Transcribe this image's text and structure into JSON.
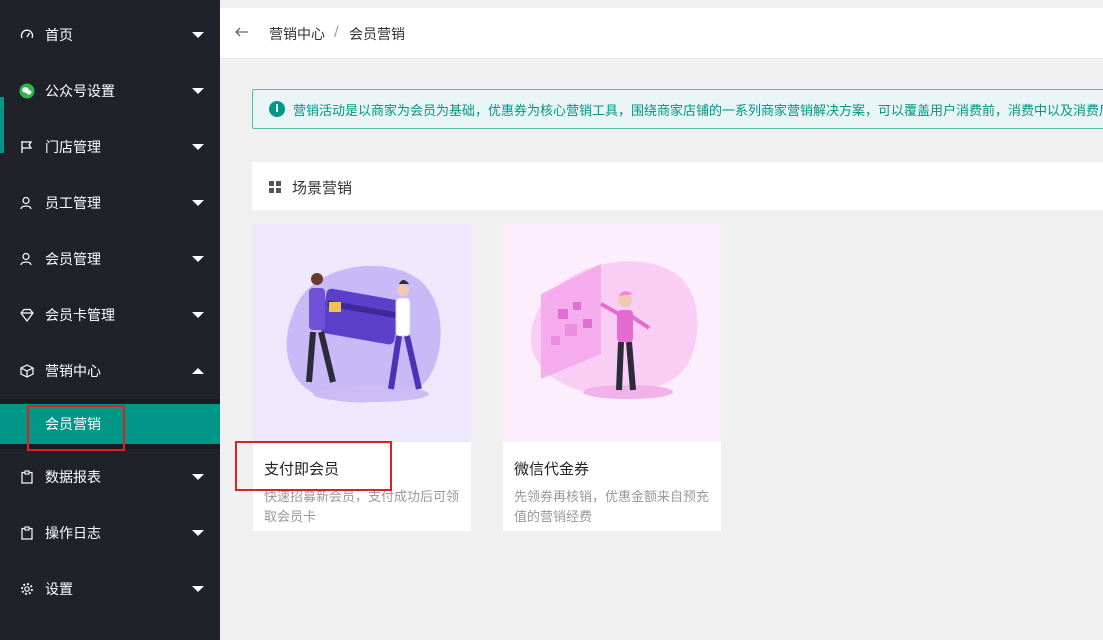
{
  "sidebar": {
    "items": [
      {
        "label": "首页",
        "icon": "dashboard-icon"
      },
      {
        "label": "公众号设置",
        "icon": "wechat-icon"
      },
      {
        "label": "门店管理",
        "icon": "flag-icon"
      },
      {
        "label": "员工管理",
        "icon": "user-icon"
      },
      {
        "label": "会员管理",
        "icon": "user-icon"
      },
      {
        "label": "会员卡管理",
        "icon": "diamond-icon"
      },
      {
        "label": "营销中心",
        "icon": "cube-icon",
        "expanded": true
      },
      {
        "label": "数据报表",
        "icon": "clipboard-icon"
      },
      {
        "label": "操作日志",
        "icon": "clipboard-icon"
      },
      {
        "label": "设置",
        "icon": "gear-icon"
      }
    ],
    "sub_items": [
      {
        "label": "会员营销",
        "active": true
      }
    ]
  },
  "breadcrumb": {
    "items": [
      "营销中心",
      "会员营销"
    ],
    "separator": "/"
  },
  "notice": {
    "text": "营销活动是以商家为会员为基础，优惠券为核心营销工具，围绕商家店铺的一系列商家营销解决方案，可以覆盖用户消费前，消费中以及消费后"
  },
  "section": {
    "title": "场景营销"
  },
  "cards": [
    {
      "title": "支付即会员",
      "desc": "快速招募新会员，支付成功后可领取会员卡"
    },
    {
      "title": "微信代金券",
      "desc": "先领券再核销，优惠金额来自预充值的营销经费"
    }
  ],
  "colors": {
    "accent": "#009688",
    "sidebar": "#20222a",
    "highlight": "#e02020"
  }
}
